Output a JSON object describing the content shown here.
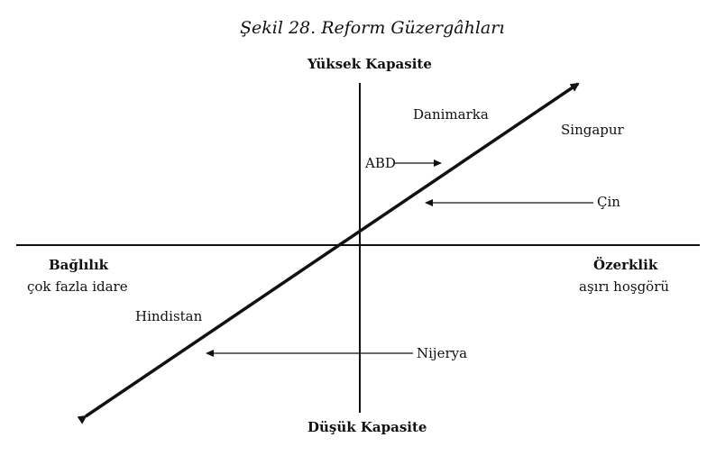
{
  "figure": {
    "title": "Şekil 28. Reform Güzergâhları",
    "axes": {
      "top": "Yüksek Kapasite",
      "bottom": "Düşük Kapasite",
      "left_title": "Bağlılık",
      "left_sub": "çok fazla idare",
      "right_title": "Özerklik",
      "right_sub": "aşırı hoşgörü"
    },
    "countries": {
      "danimarka": "Danimarka",
      "singapur": "Singapur",
      "abd": "ABD",
      "cin": "Çin",
      "hindistan": "Hindistan",
      "nijerya": "Nijerya"
    }
  }
}
